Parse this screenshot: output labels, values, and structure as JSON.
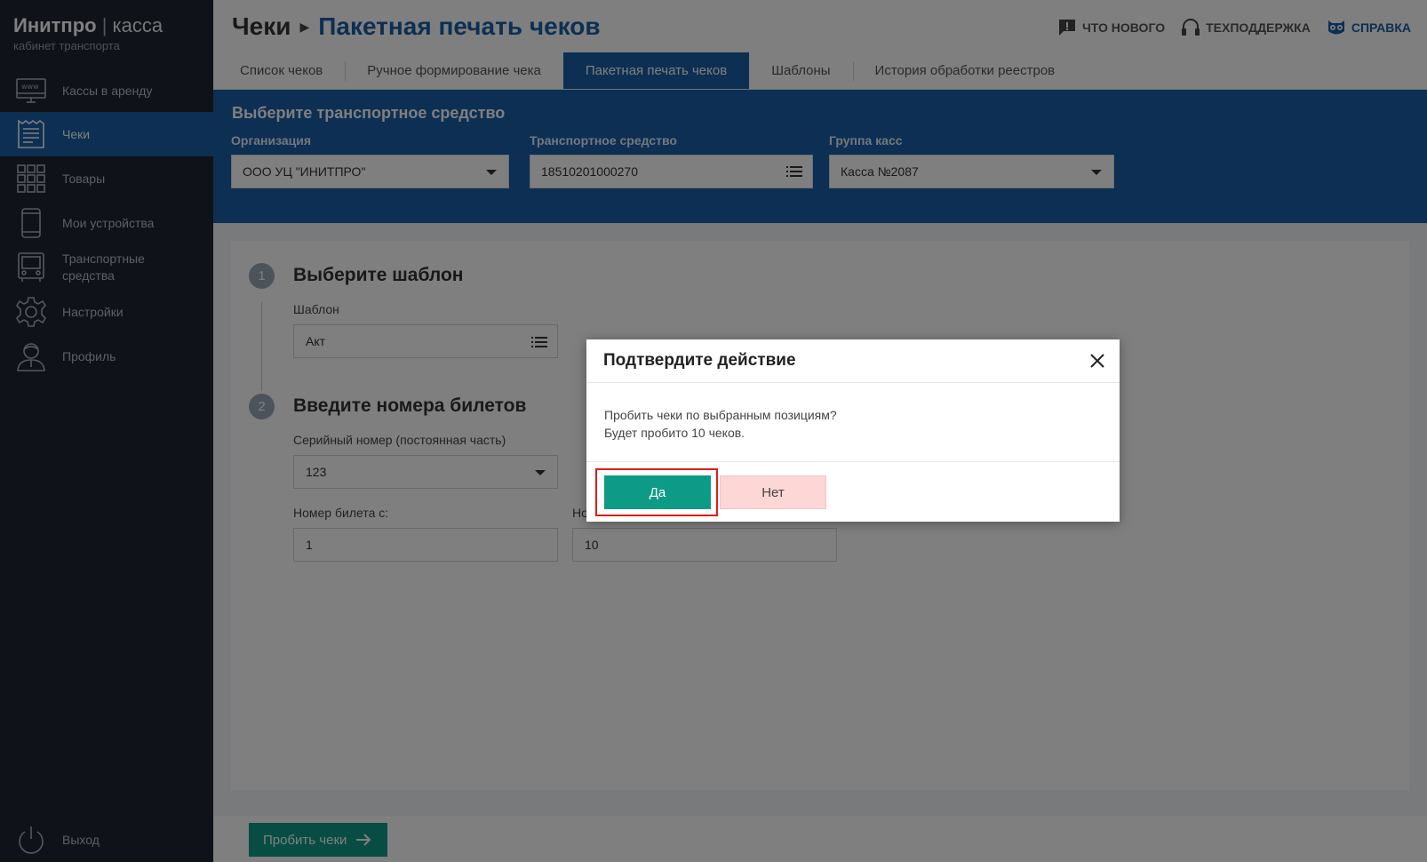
{
  "brand": {
    "name": "Инитпро",
    "separator": "|",
    "product": "касса",
    "subtitle": "кабинет транспорта"
  },
  "sidebar": {
    "items": [
      {
        "label": "Кассы в аренду",
        "icon": "www-monitor-icon"
      },
      {
        "label": "Чеки",
        "icon": "receipt-icon",
        "active": true
      },
      {
        "label": "Товары",
        "icon": "grid-icon"
      },
      {
        "label": "Мои устройства",
        "icon": "phone-icon"
      },
      {
        "label": "Транспортные средства",
        "icon": "bus-icon"
      },
      {
        "label": "Настройки",
        "icon": "gear-icon"
      },
      {
        "label": "Профиль",
        "icon": "user-icon"
      }
    ],
    "logout": {
      "label": "Выход",
      "icon": "power-icon"
    }
  },
  "header": {
    "crumb_root": "Чеки",
    "crumb_current": "Пакетная печать чеков",
    "links": {
      "whats_new": "Что нового",
      "support": "Техподдержка",
      "help": "Справка"
    }
  },
  "tabs": [
    {
      "label": "Список чеков"
    },
    {
      "label": "Ручное формирование чека"
    },
    {
      "label": "Пакетная печать чеков",
      "active": true
    },
    {
      "label": "Шаблоны"
    },
    {
      "label": "История обработки реестров"
    }
  ],
  "vehicle_panel": {
    "title": "Выберите транспортное средство",
    "org_label": "Организация",
    "org_value": "ООО УЦ \"ИНИТПРО\"",
    "vehicle_label": "Транспортное средство",
    "vehicle_value": "18510201000270",
    "group_label": "Группа касс",
    "group_value": "Касса №2087"
  },
  "steps": {
    "step1": {
      "number": "1",
      "title": "Выберите шаблон",
      "template_label": "Шаблон",
      "template_value": "Акт"
    },
    "step2": {
      "number": "2",
      "title": "Введите номера билетов",
      "serial_label": "Серийный номер (постоянная часть)",
      "serial_value": "123",
      "from_label": "Номер билета с:",
      "from_value": "1",
      "to_label": "Но",
      "to_value": "10"
    }
  },
  "footer": {
    "submit_label": "Пробить чеки"
  },
  "dialog": {
    "title": "Подтвердите действие",
    "message_line1": "Пробить чеки по выбранным позициям?",
    "message_line2": "Будет пробито 10 чеков.",
    "yes_label": "Да",
    "no_label": "Нет"
  },
  "colors": {
    "sidebar_bg": "#1f2431",
    "brand_blue": "#1a5fa6",
    "accent_green": "#0e9b86",
    "highlight_red": "#e11b1b",
    "no_button": "#fdd6d6"
  }
}
